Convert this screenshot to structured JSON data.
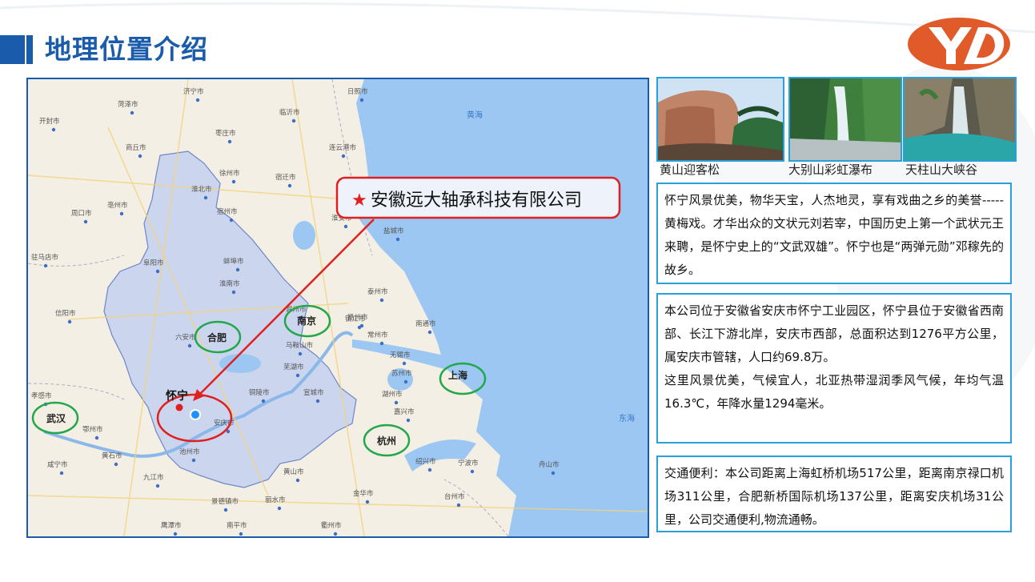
{
  "page": {
    "title": "地理位置介绍"
  },
  "brand": {
    "logo_name": "yd-logo",
    "colors": {
      "primary_blue": "#1a5cab",
      "logo_orange": "#e05a2a",
      "frame_blue": "#2b9fd9",
      "callout_red": "#e02020",
      "city_green": "#22a84a"
    }
  },
  "map": {
    "callout": {
      "star": "★",
      "text": "安徽远大轴承科技有限公司"
    },
    "target_label": "怀宁",
    "sea_labels": [
      "黄海",
      "东海"
    ],
    "circled_cities": [
      "合肥",
      "南京",
      "上海",
      "武汉",
      "杭州"
    ],
    "cities": [
      "菏泽市",
      "济宁市",
      "日照市",
      "临沂市",
      "枣庄市",
      "商丘市",
      "开封市",
      "连云港市",
      "徐州市",
      "宿迁市",
      "淮北市",
      "宿州市",
      "周口市",
      "亳州市",
      "淮安市",
      "盐城市",
      "阜阳市",
      "蚌埠市",
      "驻马店市",
      "淮南市",
      "滁州市",
      "扬州市",
      "泰州市",
      "镇江市",
      "南通市",
      "信阳市",
      "六安市",
      "常州市",
      "马鞍山市",
      "无锡市",
      "芜湖市",
      "苏州市",
      "铜陵市",
      "宣城市",
      "湖州市",
      "嘉兴市",
      "孝感市",
      "鄂州市",
      "安庆市",
      "池州市",
      "宁波市",
      "绍兴市",
      "咸宁市",
      "九江市",
      "黄山市",
      "景德镇市",
      "金华市",
      "衢州市",
      "舟山市",
      "黄石市",
      "台州市",
      "丽水市",
      "南平市",
      "鹰潭市"
    ]
  },
  "photos": [
    {
      "name": "huangshan-photo",
      "caption": "黄山迎客松"
    },
    {
      "name": "dabieshan-photo",
      "caption": "大别山彩虹瀑布"
    },
    {
      "name": "tianzhushan-photo",
      "caption": "天柱山大峡谷"
    }
  ],
  "info": {
    "culture": "怀宁风景优美，物华天宝，人杰地灵，享有戏曲之乡的美誉-----黄梅戏。才华出众的文状元刘若宰，中国历史上第一个武状元王来聘，是怀宁史上的“文武双雄”。怀宁也是“两弹元勋”邓稼先的故乡。",
    "location_p1": "本公司位于安徽省安庆市怀宁工业园区，怀宁县位于安徽省西南部、长江下游北岸，安庆市西部，总面积达到1276平方公里，属安庆市管辖，人口约69.8万。",
    "location_p2": "这里风景优美，气候宜人，北亚热带湿润季风气候，年均气温16.3℃，年降水量1294毫米。",
    "transport": "交通便利：本公司距离上海虹桥机场517公里，距离南京禄口机场311公里，合肥新桥国际机场137公里，距离安庆机场31公里，公司交通便利,物流通畅。"
  }
}
